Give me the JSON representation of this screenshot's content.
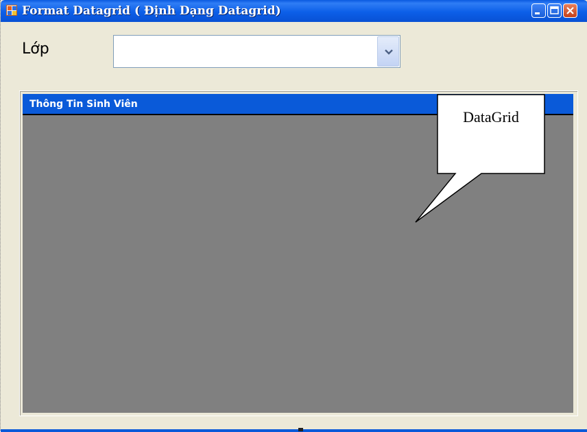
{
  "window": {
    "title": "Format Datagrid  ( Định Dạng Datagrid)",
    "title_bar_color": "#0a5ae0",
    "controls": [
      "minimize-icon",
      "maximize-icon",
      "close-icon"
    ]
  },
  "form": {
    "class_label": "Lớp",
    "class_combo_value": "",
    "combo_icon": "chevron-down-icon"
  },
  "datagrid": {
    "caption": "Thông Tin Sinh Viên",
    "caption_color": "#0a5ad9",
    "background_color": "#808080"
  },
  "annotation": {
    "callout_text": "DataGrid"
  }
}
